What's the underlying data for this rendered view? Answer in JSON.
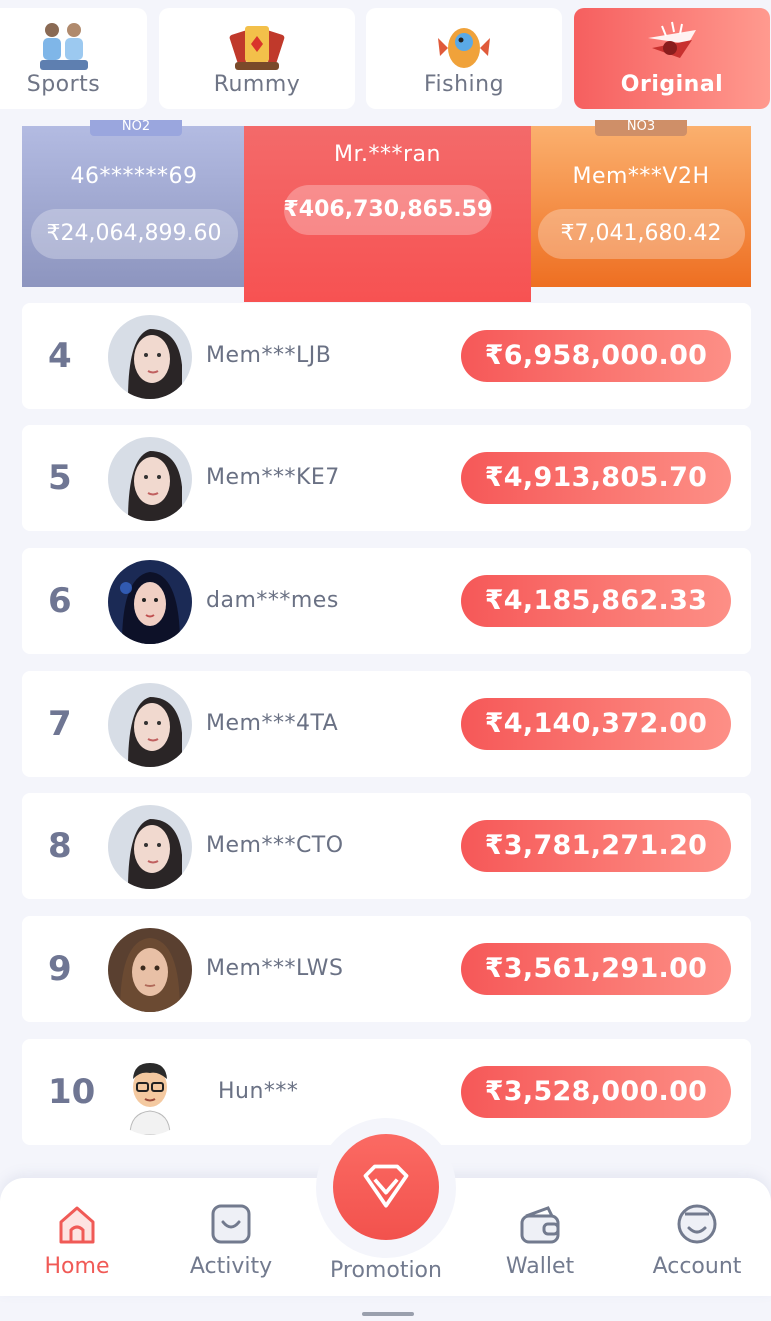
{
  "tabs": [
    {
      "label": "Sports",
      "icon": "sports-players-icon"
    },
    {
      "label": "Rummy",
      "icon": "rummy-cards-icon"
    },
    {
      "label": "Fishing",
      "icon": "fishing-fish-icon"
    },
    {
      "label": "Original",
      "icon": "original-plane-icon",
      "active": true
    }
  ],
  "podium": {
    "second": {
      "badge": "NO2",
      "name": "46******69",
      "amount": "₹24,064,899.60"
    },
    "first": {
      "name": "Mr.***ran",
      "amount": "₹406,730,865.59"
    },
    "third": {
      "badge": "NO3",
      "name": "Mem***V2H",
      "amount": "₹7,041,680.42"
    }
  },
  "ranks": [
    {
      "rank": "4",
      "name": "Mem***LJB",
      "amount": "₹6,958,000.00",
      "avatar": "girl-avatar-light"
    },
    {
      "rank": "5",
      "name": "Mem***KE7",
      "amount": "₹4,913,805.70",
      "avatar": "girl-avatar-light"
    },
    {
      "rank": "6",
      "name": "dam***mes",
      "amount": "₹4,185,862.33",
      "avatar": "girl-avatar-dark-blue"
    },
    {
      "rank": "7",
      "name": "Mem***4TA",
      "amount": "₹4,140,372.00",
      "avatar": "girl-avatar-light"
    },
    {
      "rank": "8",
      "name": "Mem***CTO",
      "amount": "₹3,781,271.20",
      "avatar": "girl-avatar-light"
    },
    {
      "rank": "9",
      "name": "Mem***LWS",
      "amount": "₹3,561,291.00",
      "avatar": "woman-avatar-brown"
    },
    {
      "rank": "10",
      "name": "Hun***",
      "amount": "₹3,528,000.00",
      "avatar": "cartoon-man-avatar"
    }
  ],
  "nav": {
    "home": "Home",
    "activity": "Activity",
    "promotion": "Promotion",
    "wallet": "Wallet",
    "account": "Account"
  },
  "colors": {
    "accent": "#f65858",
    "second_place": "#9aa3cf",
    "third_place": "#f48a3e",
    "text_muted": "#6f7586"
  }
}
